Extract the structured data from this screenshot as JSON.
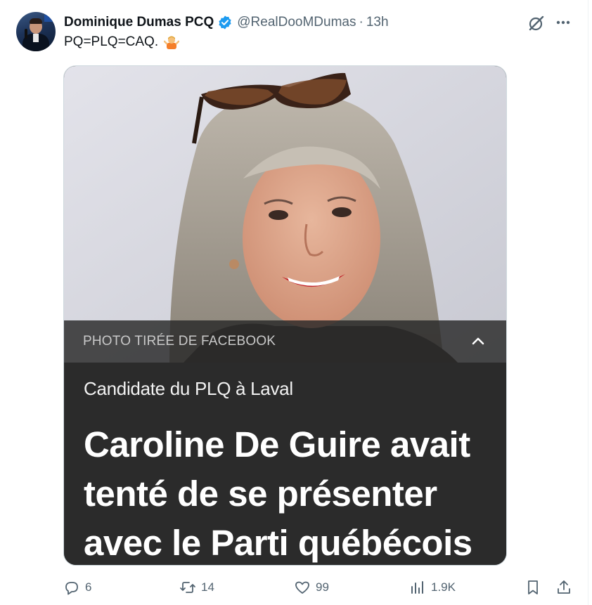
{
  "author": {
    "name": "Dominique Dumas PCQ",
    "handle": "@RealDooMDumas",
    "separator": "·",
    "time": "13h",
    "verified_icon": "verified-badge-icon",
    "verified_color": "#1d9bf0"
  },
  "tweet": {
    "text": "PQ=PLQ=CAQ.",
    "emoji_icon": "person-shrugging-emoji"
  },
  "media": {
    "photo_alt_icon": "woman-portrait-photo",
    "caption": "PHOTO TIRÉE DE FACEBOOK",
    "kicker": "Candidate du PLQ à Laval",
    "headline": "Caroline De Guire avait\ntenté de se présenter\navec le Parti québécois",
    "background_color": "#2b2b2b"
  },
  "actions": {
    "replies": "6",
    "retweets": "14",
    "likes": "99",
    "views": "1.9K"
  },
  "colors": {
    "text": "#0f1419",
    "muted": "#536471",
    "accent": "#1d9bf0"
  }
}
